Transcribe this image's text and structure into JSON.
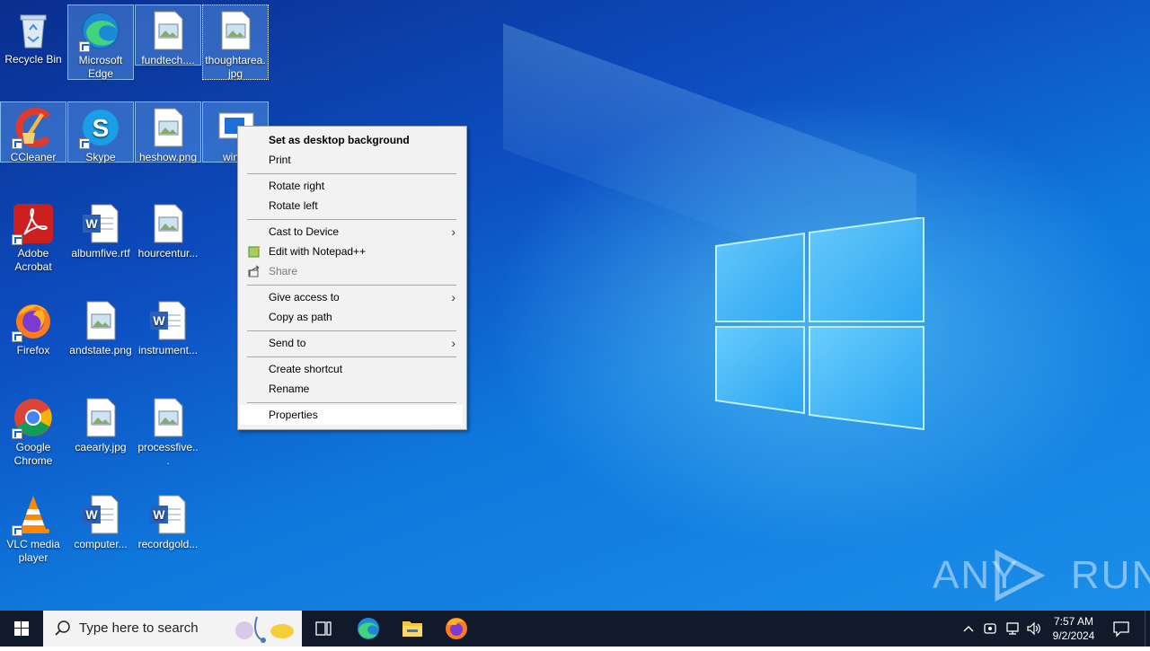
{
  "desktop": {
    "icons": [
      {
        "label": "Recycle Bin"
      },
      {
        "label": "Microsoft Edge"
      },
      {
        "label": "fundtech...."
      },
      {
        "label": "thoughtarea.jpg"
      },
      {
        "label": "CCleaner"
      },
      {
        "label": "Skype"
      },
      {
        "label": "heshow.png"
      },
      {
        "label": "win..."
      },
      {
        "label": "Adobe Acrobat"
      },
      {
        "label": "albumfive.rtf"
      },
      {
        "label": "hourcentur..."
      },
      {
        "label": "Firefox"
      },
      {
        "label": "andstate.png"
      },
      {
        "label": "instrument..."
      },
      {
        "label": "Google Chrome"
      },
      {
        "label": "caearly.jpg"
      },
      {
        "label": "processfive..."
      },
      {
        "label": "VLC media player"
      },
      {
        "label": "computer..."
      },
      {
        "label": "recordgold..."
      }
    ]
  },
  "context_menu": {
    "items": [
      {
        "label": "Set as desktop background"
      },
      {
        "label": "Print"
      },
      {
        "label": "Rotate right"
      },
      {
        "label": "Rotate left"
      },
      {
        "label": "Cast to Device"
      },
      {
        "label": "Edit with Notepad++"
      },
      {
        "label": "Share"
      },
      {
        "label": "Give access to"
      },
      {
        "label": "Copy as path"
      },
      {
        "label": "Send to"
      },
      {
        "label": "Create shortcut"
      },
      {
        "label": "Rename"
      },
      {
        "label": "Properties"
      }
    ]
  },
  "taskbar": {
    "search_placeholder": "Type here to search",
    "time": "7:57 AM",
    "date": "9/2/2024"
  },
  "watermark": {
    "text": "ANY RUN"
  },
  "colors": {
    "taskbar": "#101a2b",
    "menu_bg": "#f2f2f2",
    "desktop_blue": "#0f78dc"
  }
}
